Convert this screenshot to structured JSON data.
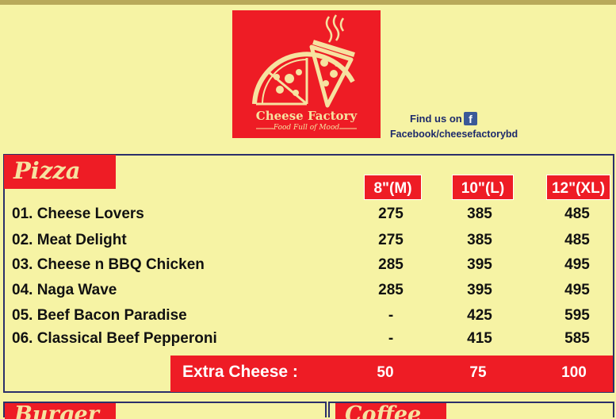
{
  "brand": {
    "name": "Cheese Factory",
    "tagline": "Food Full of Mood"
  },
  "social": {
    "find_us": "Find us on",
    "icon": "facebook-icon",
    "url": "Facebook/cheesefactorybd"
  },
  "pizza": {
    "title": "Pizza",
    "sizes": [
      "8\"(M)",
      "10\"(L)",
      "12\"(XL)"
    ],
    "items": [
      {
        "name": "01. Cheese Lovers",
        "prices": [
          "275",
          "385",
          "485"
        ]
      },
      {
        "name": "02. Meat Delight",
        "prices": [
          "275",
          "385",
          "485"
        ]
      },
      {
        "name": "03. Cheese n BBQ Chicken",
        "prices": [
          "285",
          "395",
          "495"
        ]
      },
      {
        "name": "04. Naga Wave",
        "prices": [
          "285",
          "395",
          "495"
        ]
      },
      {
        "name": "05. Beef Bacon Paradise",
        "prices": [
          "-",
          "425",
          "595"
        ]
      },
      {
        "name": "06. Classical Beef Pepperoni",
        "prices": [
          "-",
          "415",
          "585"
        ]
      }
    ],
    "extra": {
      "label": "Extra Cheese :",
      "prices": [
        "50",
        "75",
        "100"
      ]
    }
  },
  "bottom_sections": [
    "Burger",
    "Coffee"
  ],
  "colors": {
    "background": "#f6f3a4",
    "accent": "#ee1c25",
    "border": "#2b2f6a"
  }
}
